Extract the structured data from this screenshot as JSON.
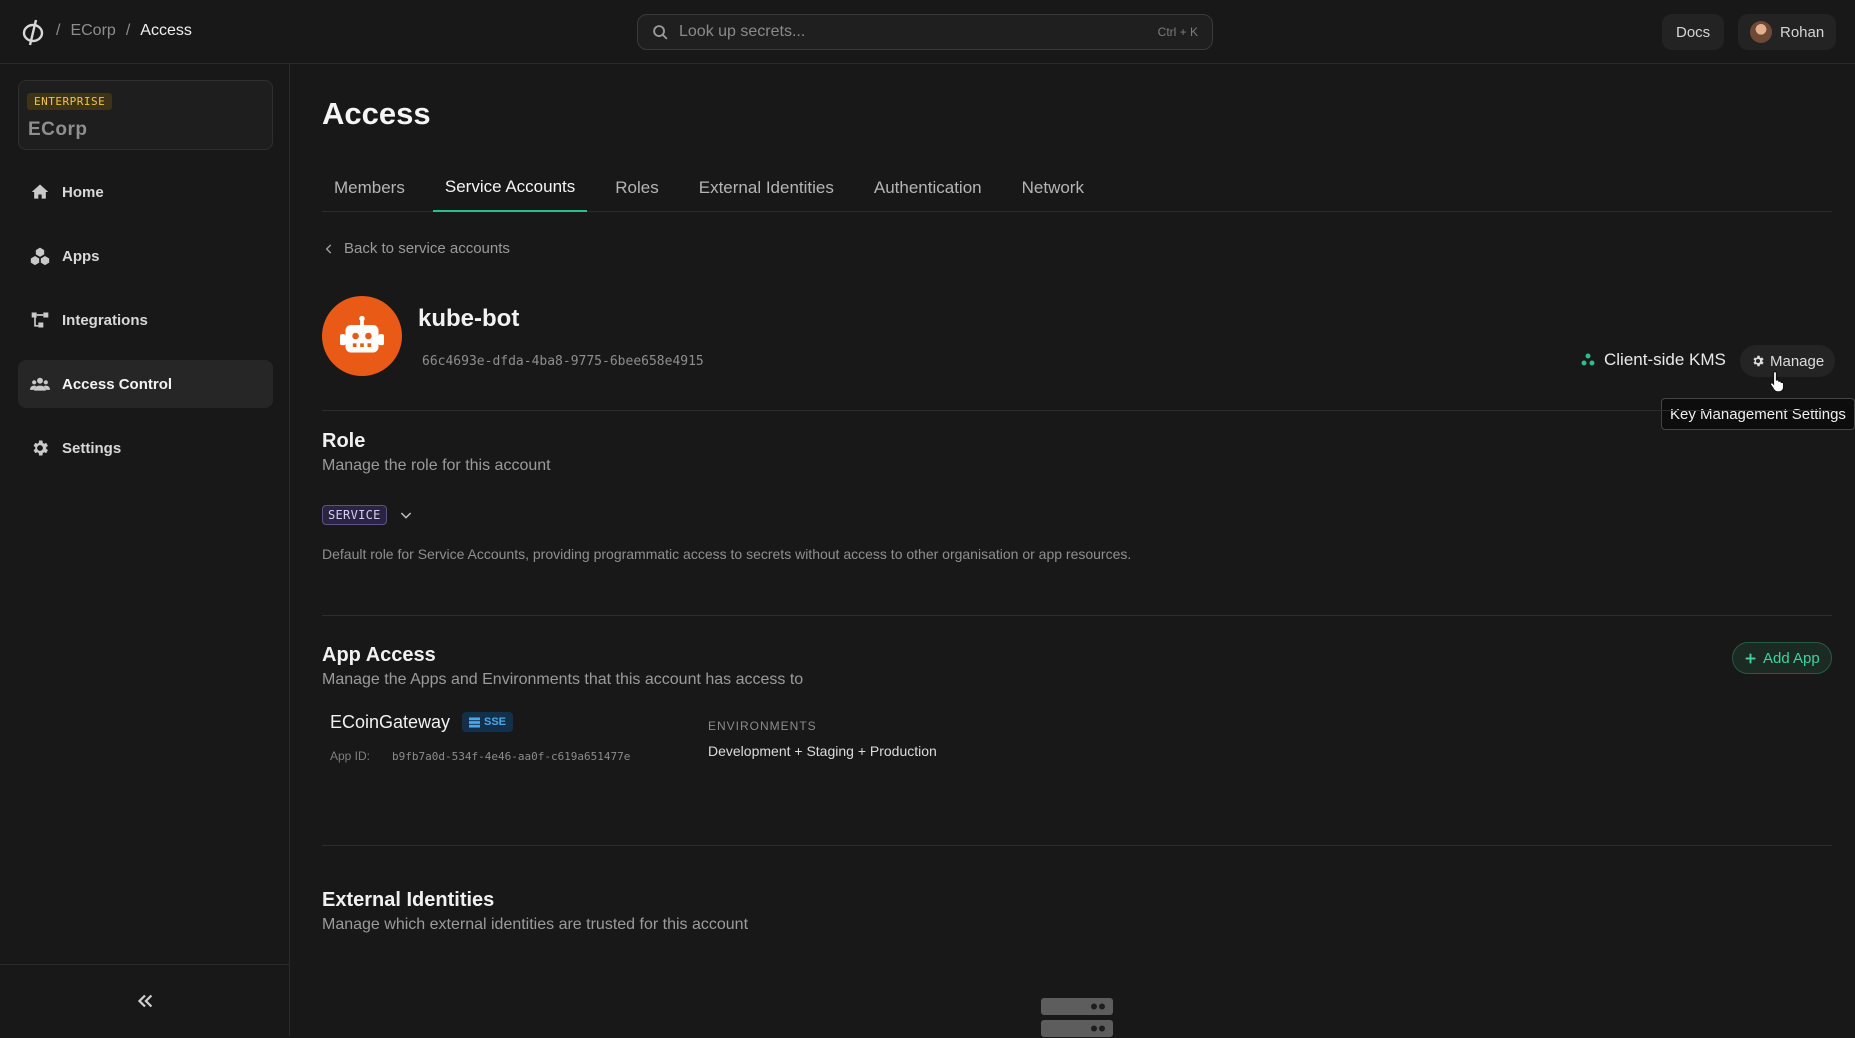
{
  "breadcrumb": {
    "sep": "/",
    "org": "ECorp",
    "page": "Access"
  },
  "search": {
    "placeholder": "Look up secrets...",
    "shortcut": "Ctrl + K"
  },
  "header": {
    "docs_label": "Docs",
    "user_name": "Rohan"
  },
  "sidebar": {
    "org_plan": "ENTERPRISE",
    "org_name": "ECorp",
    "items": [
      {
        "label": "Home",
        "icon": "home-icon",
        "active": false
      },
      {
        "label": "Apps",
        "icon": "apps-icon",
        "active": false
      },
      {
        "label": "Integrations",
        "icon": "integrations-icon",
        "active": false
      },
      {
        "label": "Access Control",
        "icon": "users-icon",
        "active": true
      },
      {
        "label": "Settings",
        "icon": "gear-icon",
        "active": false
      }
    ]
  },
  "main": {
    "title": "Access",
    "tabs": [
      {
        "label": "Members",
        "active": false
      },
      {
        "label": "Service Accounts",
        "active": true
      },
      {
        "label": "Roles",
        "active": false
      },
      {
        "label": "External Identities",
        "active": false
      },
      {
        "label": "Authentication",
        "active": false
      },
      {
        "label": "Network",
        "active": false
      }
    ],
    "back_label": "Back to service accounts",
    "account": {
      "name": "kube-bot",
      "id": "66c4693e-dfda-4ba8-9775-6bee658e4915",
      "kms_label": "Client-side KMS",
      "manage_label": "Manage",
      "tooltip": "Key Management Settings"
    },
    "role_section": {
      "title": "Role",
      "description": "Manage the role for this account",
      "role": "SERVICE",
      "role_description": "Default role for Service Accounts, providing programmatic access to secrets without access to other organisation or app resources."
    },
    "app_access": {
      "title": "App Access",
      "description": "Manage the Apps and Environments that this account has access to",
      "add_label": "Add App",
      "apps": [
        {
          "name": "ECoinGateway",
          "badge": "SSE",
          "id_label": "App ID:",
          "id": "b9fb7a0d-534f-4e46-aa0f-c619a651477e",
          "env_heading": "ENVIRONMENTS",
          "environments": "Development + Staging + Production"
        }
      ]
    },
    "external_identities": {
      "title": "External Identities",
      "description": "Manage which external identities are trusted for this account"
    }
  },
  "colors": {
    "background": "#181818",
    "accent_green": "#2dbc8c",
    "avatar_orange": "#ea5a17",
    "enterprise_yellow": "#f1c34e",
    "sse_blue": "#4aa8ea"
  }
}
